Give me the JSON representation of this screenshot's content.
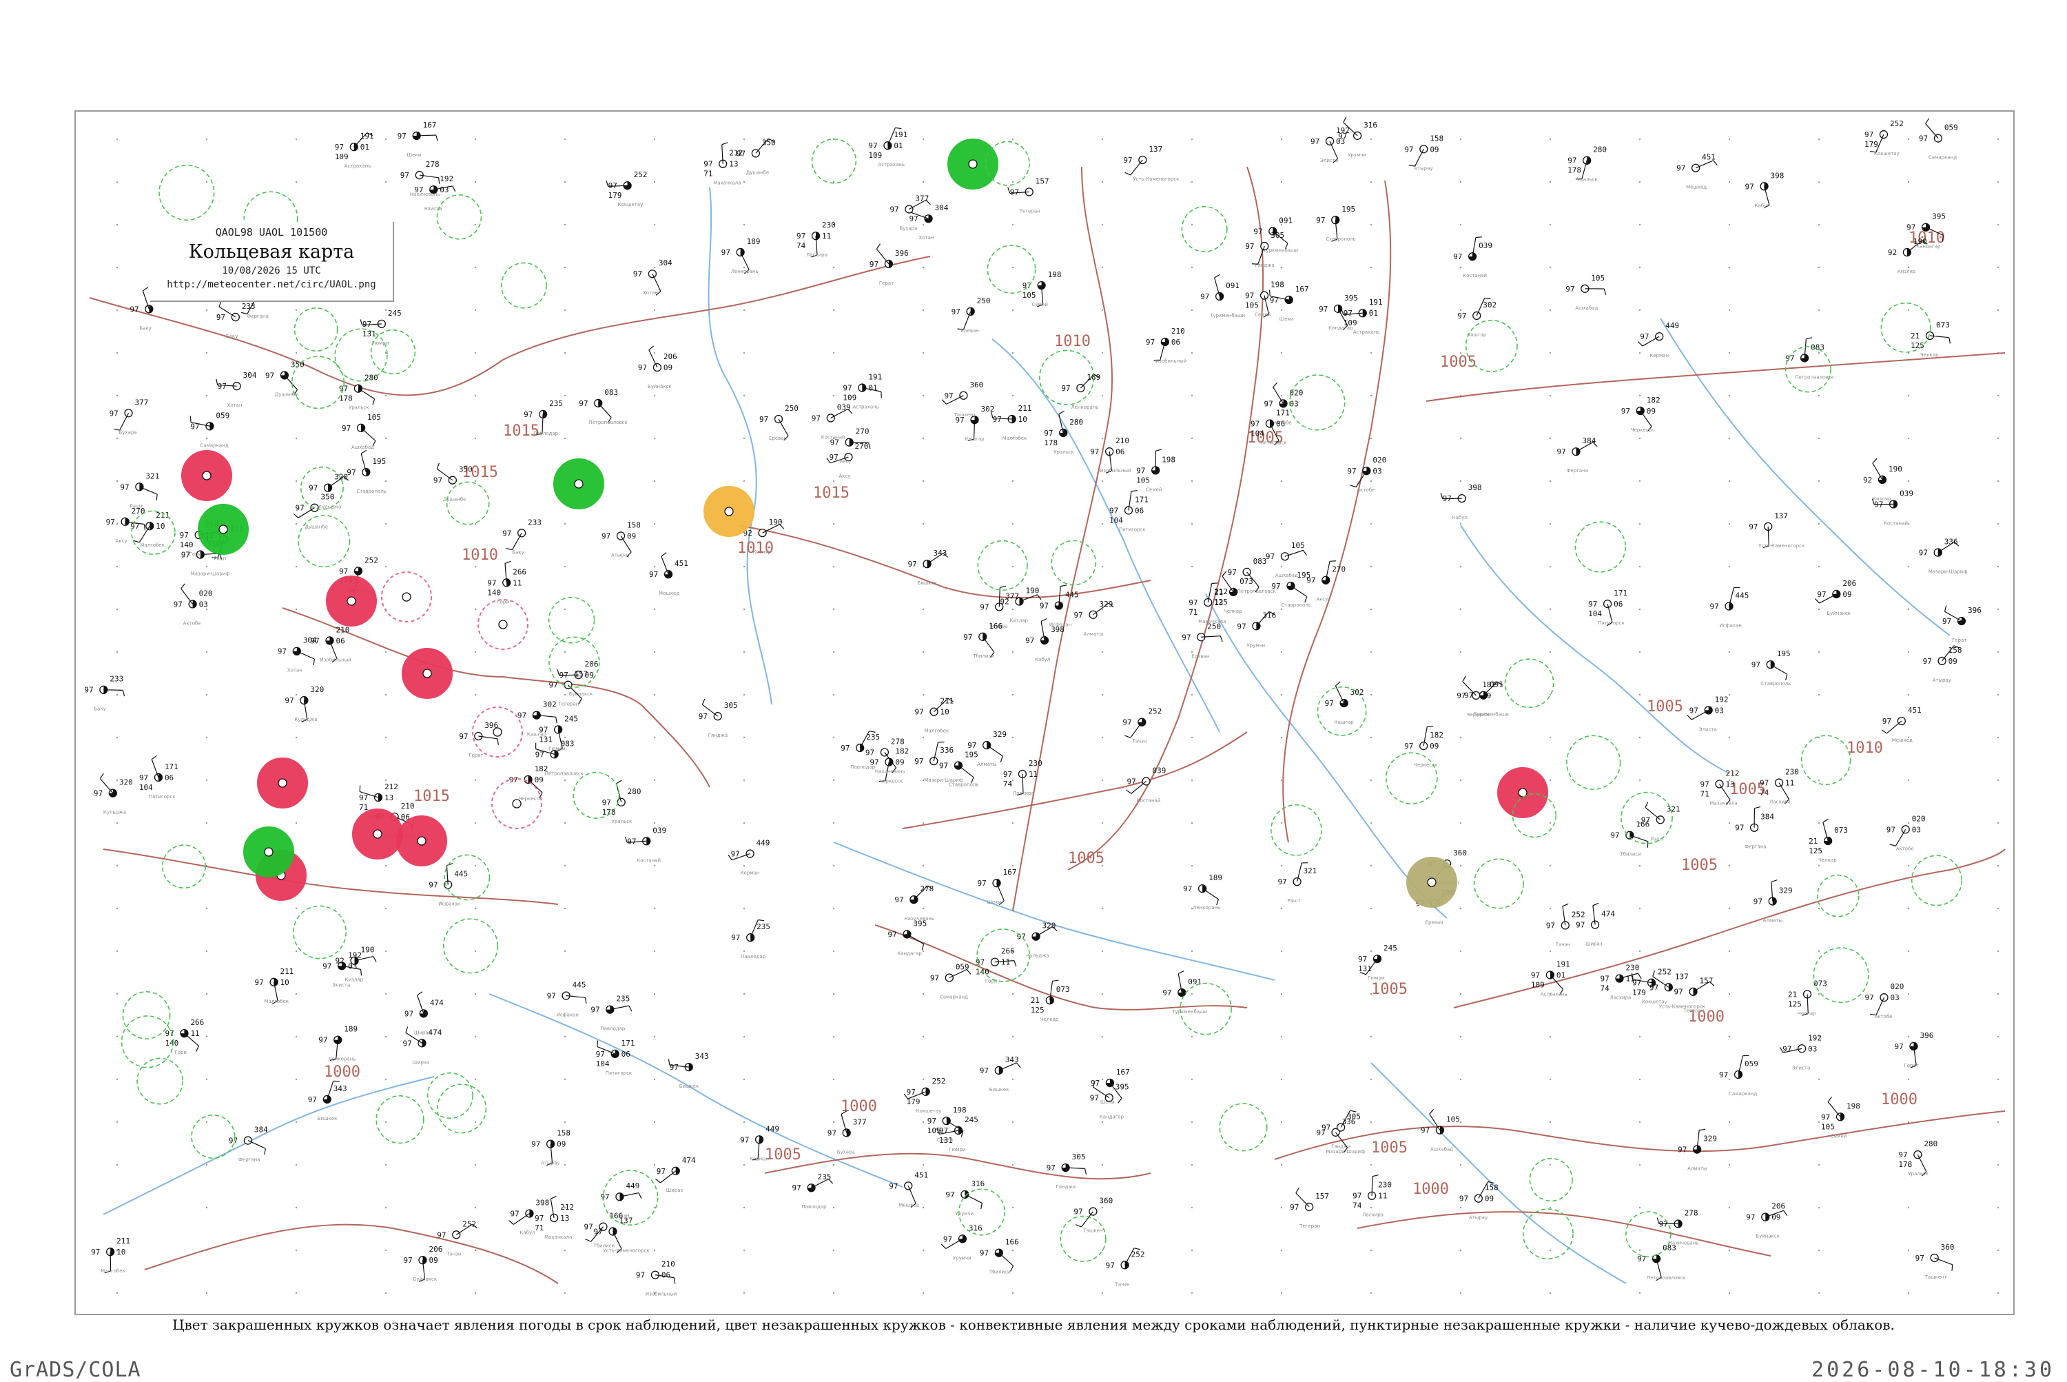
{
  "header": {
    "codes": "QAOL98  UAOL  101500",
    "title": "Кольцевая карта",
    "time": "10/08/2026 15 UTC",
    "url": "http://meteocenter.net/circ/UAOL.png"
  },
  "caption": "Цвет закрашенных кружков означает явления погоды в срок наблюдений, цвет незакрашенных кружков - конвективные явления между сроками наблюдений, пунктирные незакрашенные кружки - наличие кучево-дождевых облаков.",
  "footer": {
    "software": "GrADS/COLA",
    "timestamp": "2026-08-10-18:30"
  },
  "colors": {
    "isobar": "#b5655a",
    "river": "#7fb6e6",
    "filled_red": "#e8375a",
    "filled_green": "#1fbf2c",
    "filled_orange": "#f3b640",
    "filled_olive": "#b5ad72",
    "dashed_green": "#44c44a",
    "ring_pink": "#e66a8a"
  },
  "isobar_labels": [
    "1015",
    "1015",
    "1015",
    "1015",
    "1010",
    "1010",
    "1010",
    "1010",
    "1005",
    "1005",
    "1005",
    "1005",
    "1005",
    "1005",
    "1005",
    "1005",
    "1005",
    "1000",
    "1000",
    "1000",
    "1000",
    "1000",
    "1010"
  ],
  "stations": [
    {
      "p": "230",
      "t": "97",
      "ww": "11",
      "n": "74",
      "name": "Ласхира"
    },
    {
      "p": "211",
      "t": "97",
      "ww": "10",
      "n": "",
      "name": "Малгобек"
    },
    {
      "p": "212",
      "t": "97",
      "ww": "13",
      "n": "71",
      "name": "Махачкала"
    },
    {
      "p": "195",
      "t": "97",
      "ww": "",
      "n": "",
      "name": "Ставрополь"
    },
    {
      "p": "191",
      "t": "97",
      "ww": "01",
      "n": "109",
      "name": "Астрахань"
    },
    {
      "p": "192",
      "t": "97",
      "ww": "03",
      "n": "",
      "name": "Элиста"
    },
    {
      "p": "210",
      "t": "97",
      "ww": "06",
      "n": "",
      "name": "Изобильный"
    },
    {
      "p": "182",
      "t": "97",
      "ww": "09",
      "n": "",
      "name": "Черкесск"
    },
    {
      "p": "206",
      "t": "97",
      "ww": "09",
      "n": "",
      "name": "Буйнакск"
    },
    {
      "p": "171",
      "t": "97",
      "ww": "06",
      "n": "104",
      "name": "Пятигорск"
    },
    {
      "p": "190",
      "t": "92",
      "ww": "",
      "n": "",
      "name": "Кизляр"
    },
    {
      "p": "158",
      "t": "97",
      "ww": "09",
      "n": "",
      "name": "Атырау"
    },
    {
      "p": "073",
      "t": "21",
      "ww": "",
      "n": "125",
      "name": "Челкар"
    },
    {
      "p": "280",
      "t": "97",
      "ww": "",
      "n": "178",
      "name": "Уральск"
    },
    {
      "p": "020",
      "t": "97",
      "ww": "03",
      "n": "",
      "name": "Актобе"
    },
    {
      "p": "039",
      "t": "97",
      "ww": "",
      "n": "",
      "name": "Костанай"
    },
    {
      "p": "252",
      "t": "97",
      "ww": "",
      "n": "179",
      "name": "Кокшетау"
    },
    {
      "p": "083",
      "t": "97",
      "ww": "",
      "n": "",
      "name": "Петропавловск"
    },
    {
      "p": "235",
      "t": "97",
      "ww": "",
      "n": "",
      "name": "Павлодар"
    },
    {
      "p": "198",
      "t": "97",
      "ww": "",
      "n": "105",
      "name": "Семей"
    },
    {
      "p": "137",
      "t": "97",
      "ww": "",
      "n": "",
      "name": "Усть-Каменогорск"
    },
    {
      "p": "266",
      "t": "97",
      "ww": "11",
      "n": "140",
      "name": "Гори"
    },
    {
      "p": "166",
      "t": "97",
      "ww": "",
      "n": "",
      "name": "Тбилиси"
    },
    {
      "p": "250",
      "t": "97",
      "ww": "",
      "n": "",
      "name": "Ереван"
    },
    {
      "p": "245",
      "t": "97",
      "ww": "",
      "n": "131",
      "name": "Гюмри"
    },
    {
      "p": "189",
      "t": "97",
      "ww": "",
      "n": "",
      "name": "Ленкорань"
    },
    {
      "p": "233",
      "t": "97",
      "ww": "",
      "n": "",
      "name": "Баку"
    },
    {
      "p": "305",
      "t": "97",
      "ww": "",
      "n": "",
      "name": "Гянджа"
    },
    {
      "p": "278",
      "t": "97",
      "ww": "",
      "n": "",
      "name": "Нахичевань"
    },
    {
      "p": "167",
      "t": "97",
      "ww": "",
      "n": "",
      "name": "Шеки"
    },
    {
      "p": "157",
      "t": "97",
      "ww": "",
      "n": "",
      "name": "Тегеран"
    },
    {
      "p": "321",
      "t": "97",
      "ww": "",
      "n": "",
      "name": "Рашт"
    },
    {
      "p": "105",
      "t": "97",
      "ww": "",
      "n": "",
      "name": "Ашхабад"
    },
    {
      "p": "091",
      "t": "97",
      "ww": "",
      "n": "",
      "name": "Туркменбаши"
    },
    {
      "p": "377",
      "t": "97",
      "ww": "",
      "n": "",
      "name": "Бухара"
    },
    {
      "p": "059",
      "t": "97",
      "ww": "",
      "n": "",
      "name": "Самарканд"
    },
    {
      "p": "360",
      "t": "97",
      "ww": "",
      "n": "",
      "name": "Ташкент"
    },
    {
      "p": "384",
      "t": "97",
      "ww": "",
      "n": "",
      "name": "Фергана"
    },
    {
      "p": "350",
      "t": "97",
      "ww": "",
      "n": "",
      "name": "Душанбе"
    },
    {
      "p": "343",
      "t": "97",
      "ww": "",
      "n": "",
      "name": "Бишкек"
    },
    {
      "p": "329",
      "t": "97",
      "ww": "",
      "n": "",
      "name": "Алматы"
    },
    {
      "p": "302",
      "t": "97",
      "ww": "",
      "n": "",
      "name": "Кашгар"
    },
    {
      "p": "316",
      "t": "97",
      "ww": "",
      "n": "",
      "name": "Урумчи"
    },
    {
      "p": "320",
      "t": "97",
      "ww": "",
      "n": "",
      "name": "Кульджа"
    },
    {
      "p": "252",
      "t": "97",
      "ww": "",
      "n": "",
      "name": "Тачэн"
    },
    {
      "p": "304",
      "t": "97",
      "ww": "",
      "n": "",
      "name": "Хотан"
    },
    {
      "p": "270",
      "t": "97",
      "ww": "",
      "n": "",
      "name": "Аксу"
    },
    {
      "p": "398",
      "t": "97",
      "ww": "",
      "n": "",
      "name": "Кабул"
    },
    {
      "p": "336",
      "t": "97",
      "ww": "",
      "n": "",
      "name": "Мазари-Шариф"
    },
    {
      "p": "395",
      "t": "97",
      "ww": "",
      "n": "",
      "name": "Кандагар"
    },
    {
      "p": "396",
      "t": "97",
      "ww": "",
      "n": "",
      "name": "Герат"
    },
    {
      "p": "451",
      "t": "97",
      "ww": "",
      "n": "",
      "name": "Мешхед"
    },
    {
      "p": "445",
      "t": "97",
      "ww": "",
      "n": "",
      "name": "Исфахан"
    },
    {
      "p": "474",
      "t": "97",
      "ww": "",
      "n": "",
      "name": "Шираз"
    },
    {
      "p": "449",
      "t": "97",
      "ww": "",
      "n": "",
      "name": "Керман"
    }
  ],
  "storm_circles": [
    {
      "kind": "filled_red"
    },
    {
      "kind": "filled_red"
    },
    {
      "kind": "filled_red"
    },
    {
      "kind": "filled_red"
    },
    {
      "kind": "filled_red"
    },
    {
      "kind": "filled_red"
    },
    {
      "kind": "filled_red"
    },
    {
      "kind": "filled_red"
    },
    {
      "kind": "filled_green"
    },
    {
      "kind": "filled_green"
    },
    {
      "kind": "filled_green"
    },
    {
      "kind": "filled_green"
    },
    {
      "kind": "filled_orange"
    },
    {
      "kind": "filled_olive"
    },
    {
      "kind": "ring_pink"
    },
    {
      "kind": "ring_pink"
    },
    {
      "kind": "ring_pink"
    },
    {
      "kind": "ring_pink"
    }
  ]
}
